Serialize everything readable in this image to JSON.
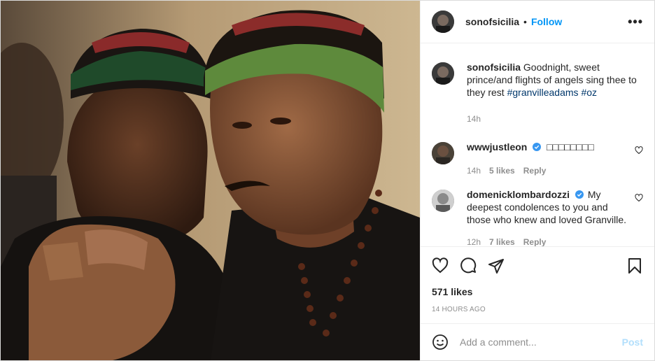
{
  "post": {
    "image_alt": "Photo of a man in a knitted kufi cap with clasped hands",
    "username": "sonofsicilia",
    "dot": "•",
    "follow_label": "Follow",
    "more_icon": "more-options-icon",
    "more_label": "•••"
  },
  "caption": {
    "username": "sonofsicilia",
    "text": "Goodnight, sweet prince/and flights of angels sing thee to they rest",
    "hashtags": [
      "#granvilleadams",
      "#oz"
    ],
    "time": "14h"
  },
  "comments": [
    {
      "username": "wwwjustleon",
      "verified": true,
      "text": "□□□□□□□□",
      "time": "14h",
      "likes": "5 likes",
      "reply": "Reply"
    },
    {
      "username": "domenicklombardozzi",
      "verified": true,
      "text": "My deepest condolences to you and those who knew and loved Granville.",
      "time": "12h",
      "likes": "7 likes",
      "reply": "Reply"
    }
  ],
  "actions": {
    "like_icon": "heart-icon",
    "comment_icon": "comment-icon",
    "share_icon": "share-icon",
    "save_icon": "bookmark-icon"
  },
  "likes_count": "571 likes",
  "posted_ago": "14 HOURS AGO",
  "add_comment": {
    "emoji_icon": "emoji-icon",
    "placeholder": "Add a comment...",
    "post_label": "Post"
  },
  "colors": {
    "accent": "#0095f6",
    "link": "#00376b",
    "muted": "#8e8e8e",
    "post_disabled": "#b2dffc"
  }
}
